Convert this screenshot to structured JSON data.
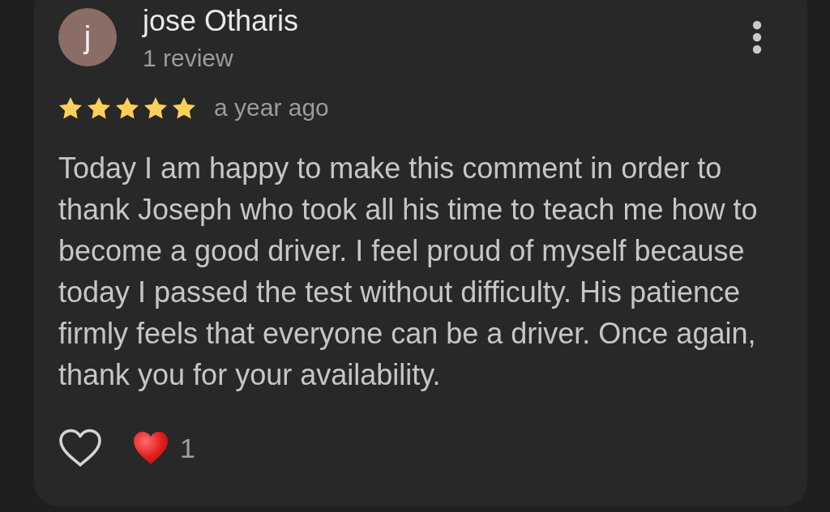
{
  "review": {
    "author": {
      "initial": "j",
      "name": "jose Otharis",
      "review_count": "1 review"
    },
    "stars": 5,
    "time": "a year ago",
    "text": "Today I am happy to make this comment in order to thank Joseph who took all his time to teach me how to become a good driver. I feel proud of myself because today I passed the test without difficulty. His patience firmly feels that everyone can be a driver. Once again, thank you for your availability.",
    "actions": {
      "liked": false,
      "reaction_count": "1"
    }
  }
}
